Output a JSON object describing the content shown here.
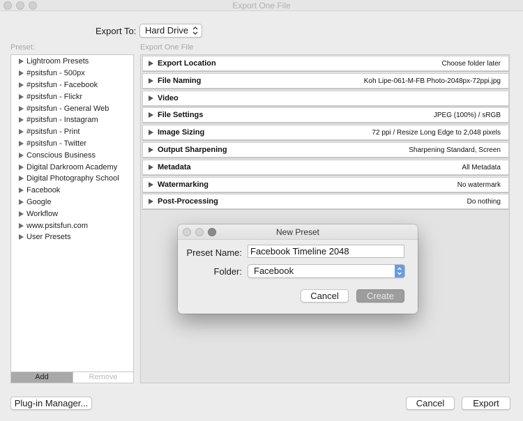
{
  "window": {
    "title": "Export One File"
  },
  "export_to": {
    "label": "Export To:",
    "value": "Hard Drive"
  },
  "presets": {
    "label": "Preset:",
    "items": [
      "Lightroom Presets",
      "#psitsfun - 500px",
      "#psitsfun - Facebook",
      "#psitsfun - Flickr",
      "#psitsfun - General Web",
      "#psitsfun - Instagram",
      "#psitsfun - Print",
      "#psitsfun - Twitter",
      "Conscious Business",
      "Digital Darkroom Academy",
      "Digital Photography School",
      "Facebook",
      "Google",
      "Workflow",
      "www.psitsfun.com",
      "User Presets"
    ],
    "add_label": "Add",
    "remove_label": "Remove"
  },
  "sections": {
    "label": "Export One File",
    "items": [
      {
        "title": "Export Location",
        "value": "Choose folder later"
      },
      {
        "title": "File Naming",
        "value": "Koh Lipe-061-M-FB Photo-2048px-72ppi.jpg"
      },
      {
        "title": "Video",
        "value": ""
      },
      {
        "title": "File Settings",
        "value": "JPEG (100%) / sRGB"
      },
      {
        "title": "Image Sizing",
        "value": "72 ppi / Resize Long Edge to 2,048 pixels"
      },
      {
        "title": "Output Sharpening",
        "value": "Sharpening Standard, Screen"
      },
      {
        "title": "Metadata",
        "value": "All Metadata"
      },
      {
        "title": "Watermarking",
        "value": "No watermark"
      },
      {
        "title": "Post-Processing",
        "value": "Do nothing"
      }
    ]
  },
  "dialog": {
    "title": "New Preset",
    "preset_name_label": "Preset Name:",
    "preset_name_value": "Facebook Timeline 2048",
    "folder_label": "Folder:",
    "folder_value": "Facebook",
    "cancel_label": "Cancel",
    "create_label": "Create"
  },
  "footer": {
    "plugin_manager_label": "Plug-in Manager...",
    "cancel_label": "Cancel",
    "export_label": "Export"
  }
}
